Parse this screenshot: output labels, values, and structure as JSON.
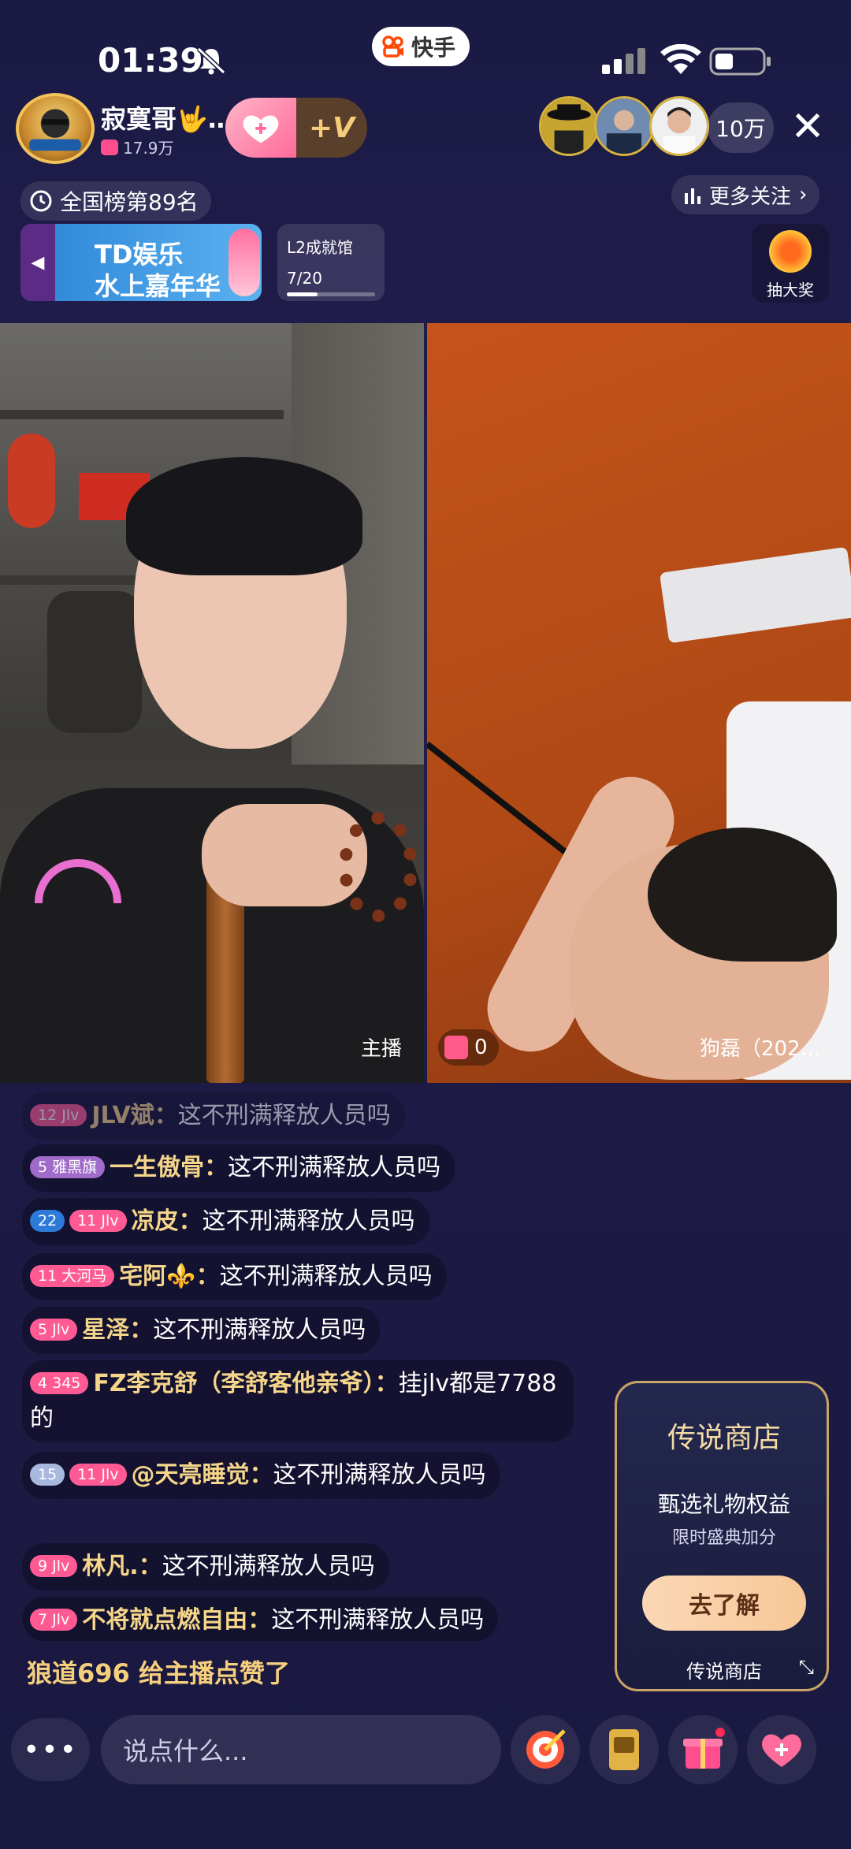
{
  "status_bar": {
    "time": "01:39",
    "app_pill": "快手"
  },
  "header": {
    "host_name": "寂寞哥🤟…",
    "host_fans": "17.9万",
    "viewer_count": "10万",
    "close_glyph": "✕"
  },
  "rank": {
    "label": "全国榜第89名"
  },
  "more_follow": {
    "label": "更多关注"
  },
  "banner": {
    "line1": "TD娱乐",
    "line2": "水上嘉年华"
  },
  "task": {
    "name": "L2成就馆",
    "progress_text": "7/20",
    "progress": 0.35
  },
  "lottery": {
    "label": "抽大奖"
  },
  "video": {
    "host_label": "主播",
    "gift_count": "0",
    "guest_name": "狗磊（202…"
  },
  "chat": [
    {
      "badges": [
        {
          "text": "12 Jlv",
          "color": "#ff5a93"
        }
      ],
      "name": "JLV斌：",
      "text": "这不刑满释放人员吗"
    },
    {
      "badges": [
        {
          "text": "5 雅黑旗",
          "color": "#a06bc9"
        }
      ],
      "name": "一生傲骨：",
      "text": "这不刑满释放人员吗"
    },
    {
      "badges": [
        {
          "text": "22",
          "color": "#2e7ad8"
        },
        {
          "text": "11 Jlv",
          "color": "#ff5a93"
        }
      ],
      "name": "凉皮：",
      "text": "这不刑满释放人员吗"
    },
    {
      "badges": [
        {
          "text": "11 大河马",
          "color": "#ff5a93"
        }
      ],
      "name": "宅阿⚜️：",
      "text": "这不刑满释放人员吗"
    },
    {
      "badges": [
        {
          "text": "5 Jlv",
          "color": "#ff5a93"
        }
      ],
      "name": "星泽：",
      "text": "这不刑满释放人员吗"
    },
    {
      "badges": [
        {
          "text": "4 345",
          "color": "#ff5a93"
        }
      ],
      "name": "FZ李克舒（李舒客他亲爷）：",
      "text": "挂jlv都是7788的"
    },
    {
      "badges": [
        {
          "text": "15",
          "color": "#a8b8de"
        },
        {
          "text": "11 Jlv",
          "color": "#ff5a93"
        }
      ],
      "name": "@天亮睡觉：",
      "text": "这不刑满释放人员吗"
    },
    {
      "badges": [
        {
          "text": "9 Jlv",
          "color": "#ff5a93"
        }
      ],
      "name": "林凡.：",
      "text": "这不刑满释放人员吗"
    },
    {
      "badges": [
        {
          "text": "7 Jlv",
          "color": "#ff5a93"
        }
      ],
      "name": "不将就点燃自由：",
      "text": "这不刑满释放人员吗"
    }
  ],
  "like_message": "狼道696 给主播点赞了",
  "shop": {
    "title": "传说商店",
    "line1": "甄选礼物权益",
    "line2": "限时盛典加分",
    "button": "去了解",
    "footer": "传说商店"
  },
  "bottom_bar": {
    "input_placeholder": "说点什么...",
    "icons": [
      "target-icon",
      "shop-ticket-icon",
      "gift-icon",
      "like-heart-icon"
    ]
  },
  "colors": {
    "accent": "#ff5a93",
    "background": "#1b1940",
    "gold": "#f4d58a"
  }
}
